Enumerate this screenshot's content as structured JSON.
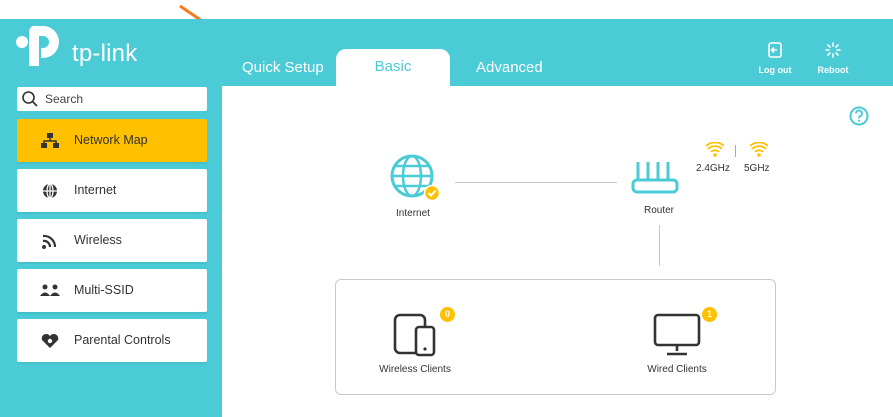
{
  "brand": {
    "name": "tp-link"
  },
  "tabs": [
    {
      "label": "Quick Setup",
      "active": false
    },
    {
      "label": "Basic",
      "active": true
    },
    {
      "label": "Advanced",
      "active": false
    }
  ],
  "top_actions": {
    "logout": "Log out",
    "reboot": "Reboot"
  },
  "search": {
    "placeholder": "Search"
  },
  "sidebar": {
    "items": [
      {
        "label": "Network Map",
        "icon": "network-map-icon",
        "active": true
      },
      {
        "label": "Internet",
        "icon": "globe-icon",
        "active": false
      },
      {
        "label": "Wireless",
        "icon": "wireless-icon",
        "active": false
      },
      {
        "label": "Multi-SSID",
        "icon": "multi-ssid-icon",
        "active": false
      },
      {
        "label": "Parental Controls",
        "icon": "heart-icon",
        "active": false
      }
    ]
  },
  "network_map": {
    "internet_label": "Internet",
    "router_label": "Router",
    "bands": [
      "2.4GHz",
      "5GHz"
    ],
    "wireless_clients": {
      "label": "Wireless Clients",
      "count": "0"
    },
    "wired_clients": {
      "label": "Wired Clients",
      "count": "1"
    }
  },
  "colors": {
    "teal": "#4acbd6",
    "accent": "#ffc000",
    "arrow": "#f47b20"
  }
}
